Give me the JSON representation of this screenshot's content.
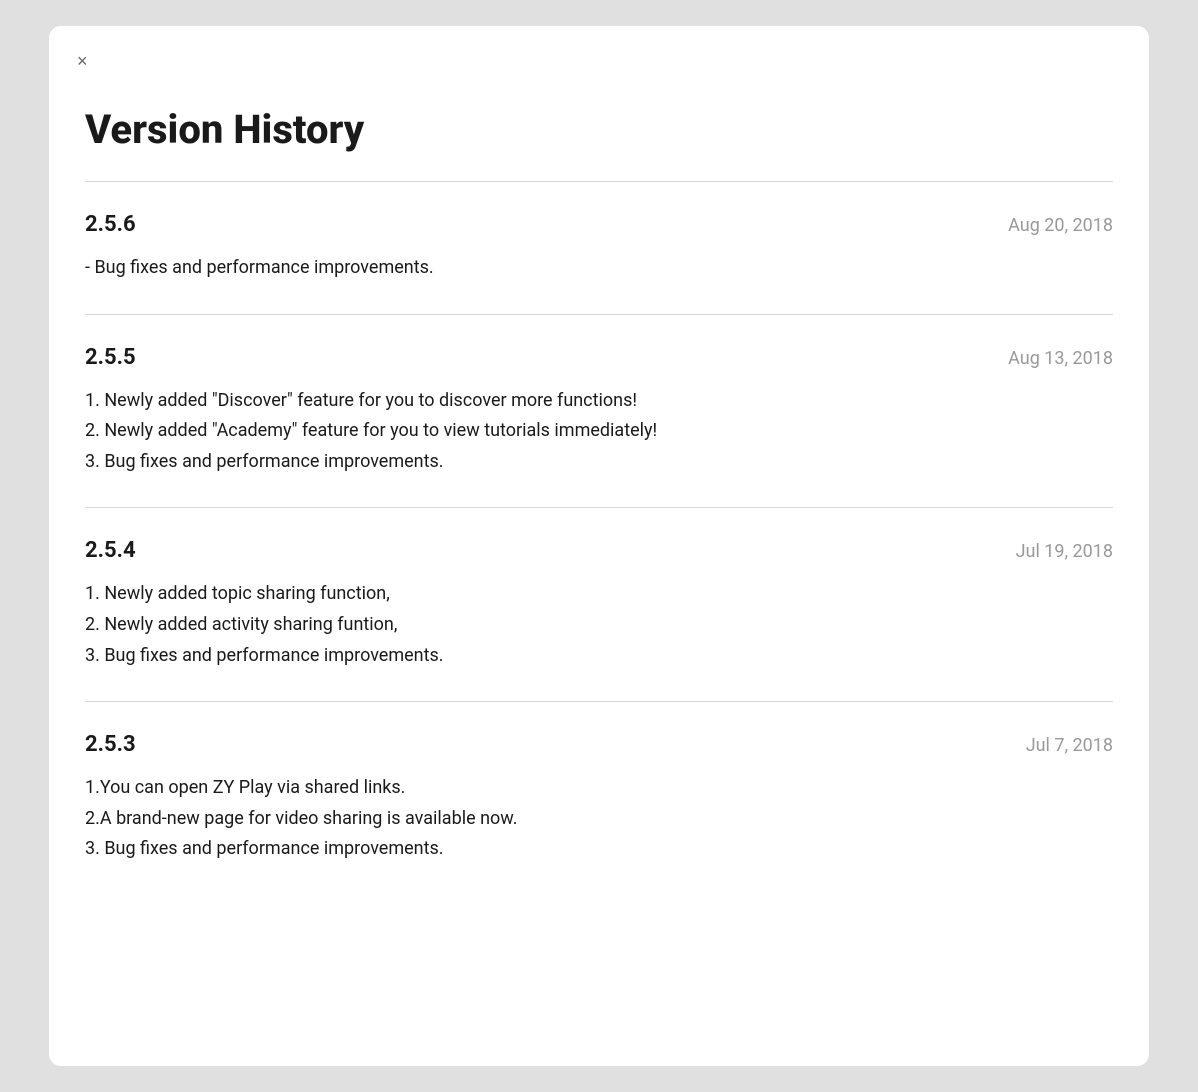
{
  "modal": {
    "close_label": "×",
    "title": "Version History"
  },
  "versions": [
    {
      "number": "2.5.6",
      "date": "Aug 20, 2018",
      "notes": [
        "- Bug fixes and performance improvements."
      ]
    },
    {
      "number": "2.5.5",
      "date": "Aug 13, 2018",
      "notes": [
        "1. Newly added \"Discover\" feature for you to discover more functions!",
        "2. Newly added \"Academy\" feature for you to view tutorials immediately!",
        "3. Bug fixes and performance improvements."
      ]
    },
    {
      "number": "2.5.4",
      "date": "Jul 19, 2018",
      "notes": [
        "1. Newly added topic sharing function,",
        "2. Newly added activity sharing funtion,",
        "3. Bug fixes and performance improvements."
      ]
    },
    {
      "number": "2.5.3",
      "date": "Jul 7, 2018",
      "notes": [
        "1.You can open ZY Play via shared links.",
        "2.A brand-new page for video sharing is available now.",
        "3. Bug fixes and performance improvements."
      ]
    }
  ]
}
